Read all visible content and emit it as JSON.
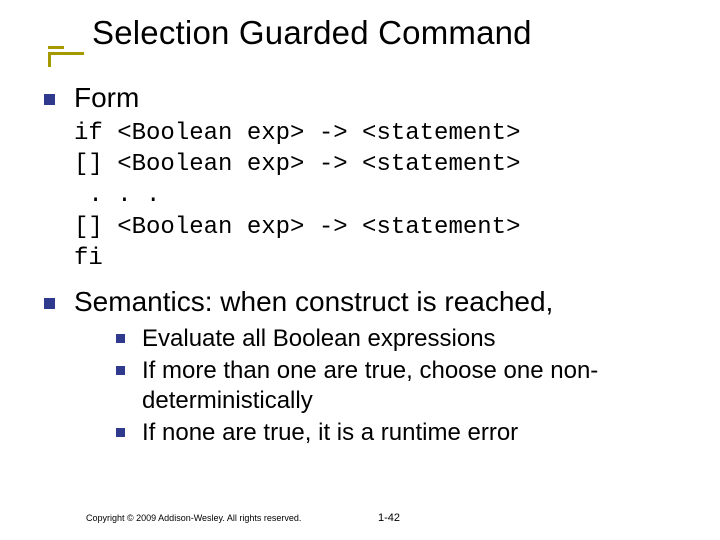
{
  "title": "Selection Guarded Command",
  "bullets": {
    "form": {
      "label": "Form",
      "code": "if <Boolean exp> -> <statement>\n[] <Boolean exp> -> <statement>\n . . .\n[] <Boolean exp> -> <statement>\nfi"
    },
    "semantics": {
      "label": "Semantics: when construct is reached,",
      "items": [
        "Evaluate all Boolean expressions",
        "If more than one are true, choose one non-deterministically",
        "If none are true, it is a runtime error"
      ]
    }
  },
  "footer": {
    "copyright": "Copyright © 2009 Addison-Wesley. All rights reserved.",
    "page": "1-42"
  }
}
